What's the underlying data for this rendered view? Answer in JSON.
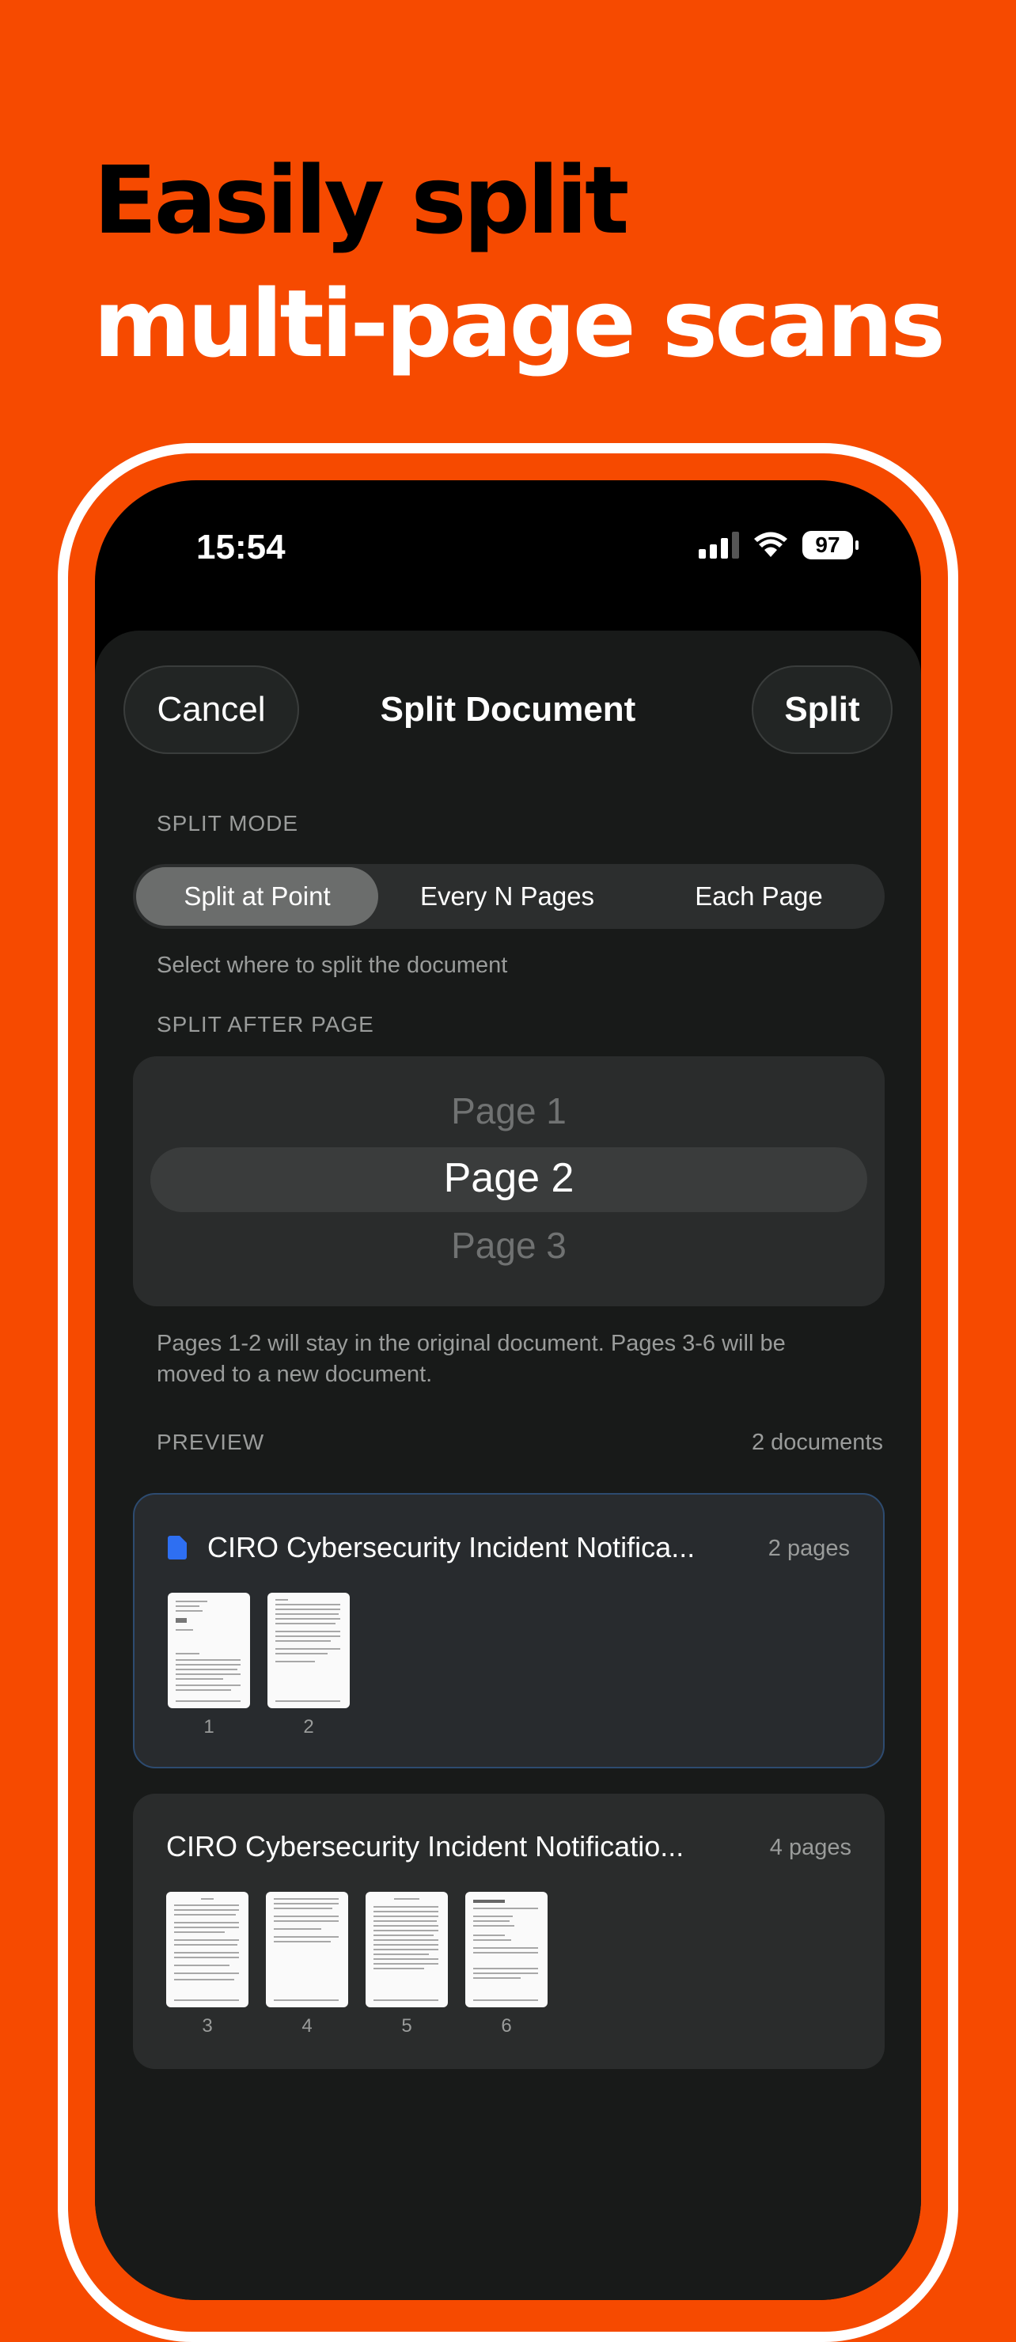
{
  "headline": {
    "line1": "Easily split",
    "line2": "multi-page scans"
  },
  "status_bar": {
    "time": "15:54",
    "battery": "97",
    "icons": [
      "signal-icon",
      "wifi-icon",
      "battery-icon"
    ]
  },
  "sheet": {
    "cancel_label": "Cancel",
    "title": "Split Document",
    "split_label": "Split"
  },
  "split_mode": {
    "label": "SPLIT MODE",
    "options": [
      "Split at Point",
      "Every N Pages",
      "Each Page"
    ],
    "selected": "Split at Point",
    "hint": "Select where to split the document"
  },
  "split_after": {
    "label": "SPLIT AFTER PAGE",
    "picker": [
      "Page 1",
      "Page 2",
      "Page 3"
    ],
    "selected": "Page 2",
    "hint_line1": "Pages 1-2 will stay in the original document. Pages 3-6 will be",
    "hint_line2": "moved to a new document."
  },
  "preview": {
    "label": "PREVIEW",
    "count": "2 documents",
    "documents": [
      {
        "title": "CIRO Cybersecurity Incident Notifica...",
        "pages_label": "2 pages",
        "pages": [
          "1",
          "2"
        ]
      },
      {
        "title": "CIRO Cybersecurity Incident Notificatio...",
        "pages_label": "4 pages",
        "pages": [
          "3",
          "4",
          "5",
          "6"
        ]
      }
    ]
  },
  "colors": {
    "background": "#F64A00",
    "sheet": "#181A19",
    "selected_border": "#2d4b70",
    "doc_icon": "#2e6ff2"
  }
}
